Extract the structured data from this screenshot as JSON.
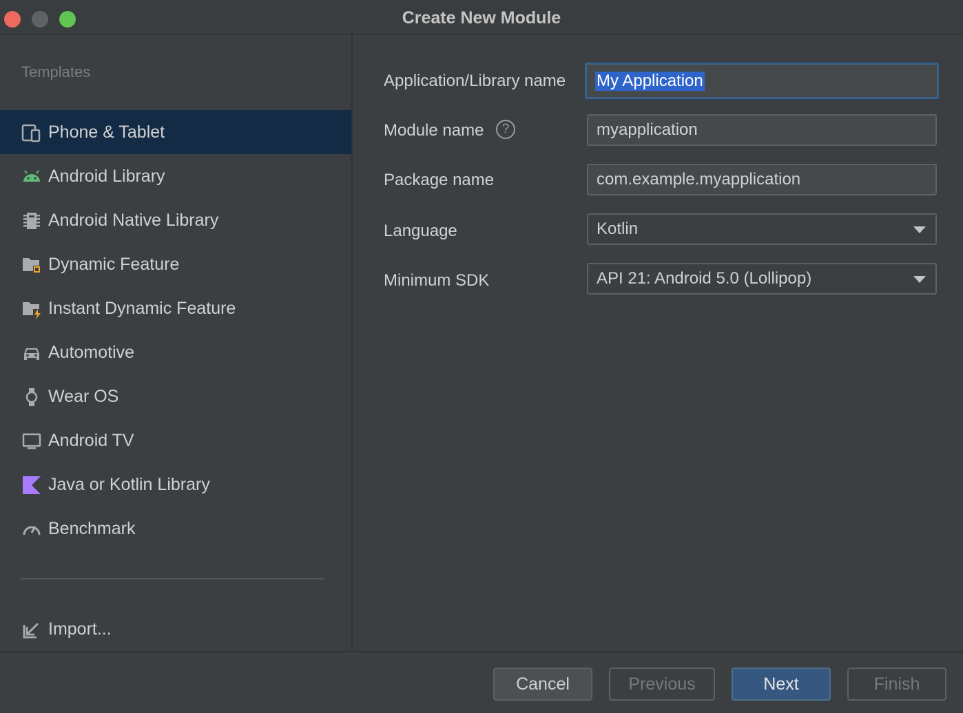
{
  "window": {
    "title": "Create New Module"
  },
  "sidebar": {
    "heading": "Templates",
    "items": [
      {
        "label": "Phone & Tablet",
        "icon": "phone-tablet-icon",
        "selected": true
      },
      {
        "label": "Android Library",
        "icon": "android-icon",
        "selected": false
      },
      {
        "label": "Android Native Library",
        "icon": "native-chip-icon",
        "selected": false
      },
      {
        "label": "Dynamic Feature",
        "icon": "folder-module-icon",
        "selected": false
      },
      {
        "label": "Instant Dynamic Feature",
        "icon": "folder-lightning-icon",
        "selected": false
      },
      {
        "label": "Automotive",
        "icon": "car-icon",
        "selected": false
      },
      {
        "label": "Wear OS",
        "icon": "watch-icon",
        "selected": false
      },
      {
        "label": "Android TV",
        "icon": "tv-icon",
        "selected": false
      },
      {
        "label": "Java or Kotlin Library",
        "icon": "kotlin-icon",
        "selected": false
      },
      {
        "label": "Benchmark",
        "icon": "gauge-icon",
        "selected": false
      }
    ],
    "import_label": "Import..."
  },
  "form": {
    "app_name_label": "Application/Library name",
    "app_name_value": "My Application",
    "module_name_label": "Module name",
    "module_name_value": "myapplication",
    "package_name_label": "Package name",
    "package_name_value": "com.example.myapplication",
    "language_label": "Language",
    "language_value": "Kotlin",
    "min_sdk_label": "Minimum SDK",
    "min_sdk_value": "API 21: Android 5.0 (Lollipop)"
  },
  "buttons": {
    "cancel": "Cancel",
    "previous": "Previous",
    "next": "Next",
    "finish": "Finish"
  },
  "colors": {
    "background": "#3c3f41",
    "selection": "#142b45",
    "accent_button": "#365880",
    "android_green": "#5fb878",
    "kotlin_purple": "#a97bff"
  }
}
